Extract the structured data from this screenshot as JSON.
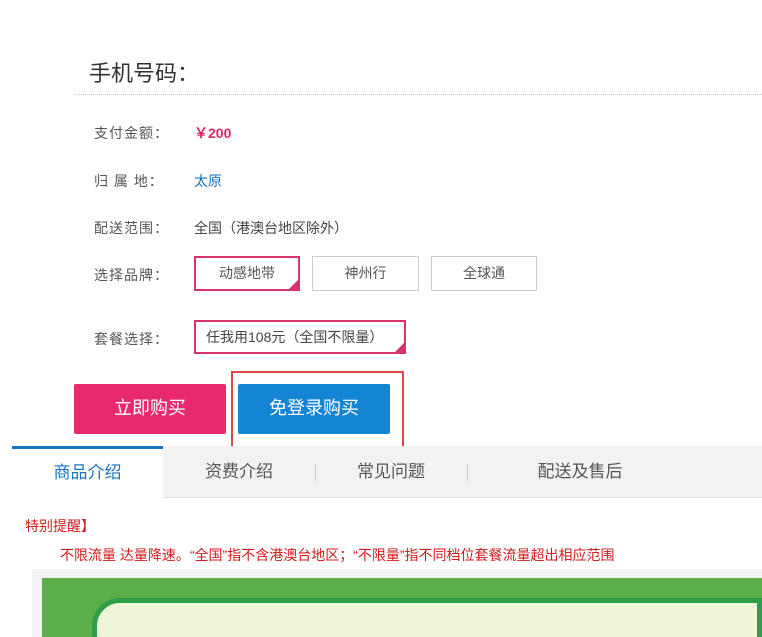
{
  "header": {
    "phone_label": "手机号码："
  },
  "rows": {
    "amount_label": "支付金额：",
    "amount_value": "￥200",
    "origin_label": "归 属 地：",
    "origin_value": "太原",
    "delivery_label": "配送范围：",
    "delivery_value": "全国（港澳台地区除外）",
    "brand_label": "选择品牌：",
    "package_label": "套餐选择："
  },
  "brands": [
    "动感地带",
    "神州行",
    "全球通"
  ],
  "package": {
    "selected": "任我用108元（全国不限量）"
  },
  "actions": {
    "buy_now": "立即购买",
    "guest_buy": "免登录购买"
  },
  "tabs": [
    "商品介绍",
    "资费介绍",
    "常见问题",
    "配送及售后"
  ],
  "notice": {
    "title": "特别提醒】",
    "text": "不限流量 达量降速。“全国”指不含港澳台地区；“不限量”指不同档位套餐流量超出相应范围"
  },
  "colors": {
    "accent_pink": "#e8296e",
    "accent_blue": "#1484d4",
    "warning_red": "#d21b1b"
  }
}
